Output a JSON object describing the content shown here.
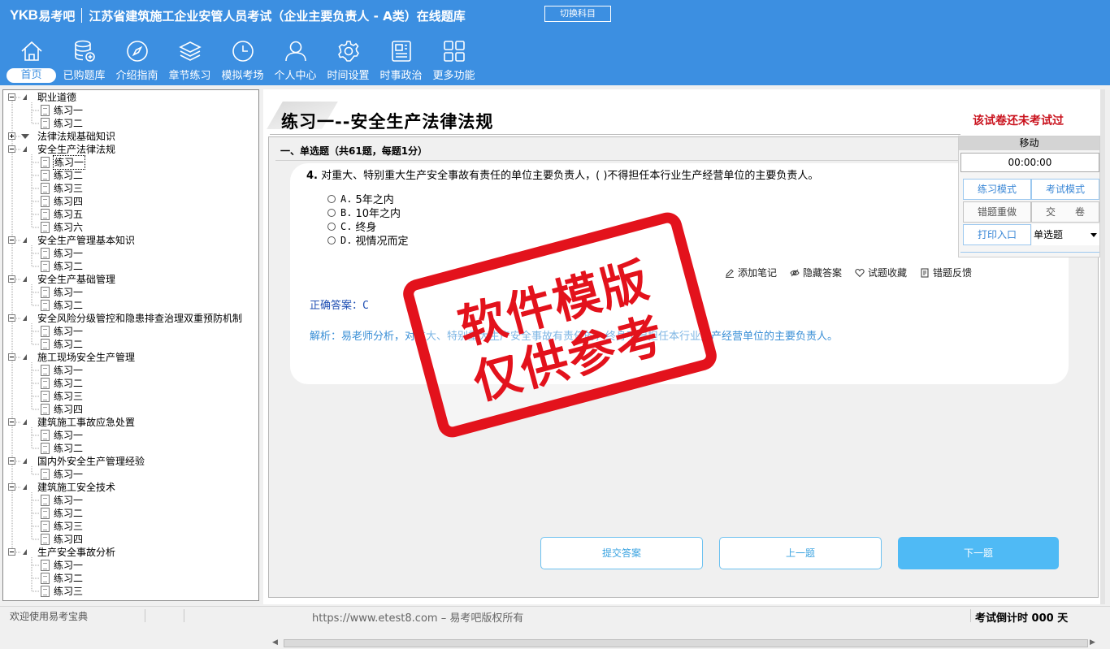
{
  "header": {
    "logo": "YKB",
    "logo_cn": "易考吧",
    "title": "江苏省建筑施工企业安管人员考试（企业主要负责人 - A类）在线题库",
    "switch_button": "切换科目",
    "bg_color": "#3c8fe1"
  },
  "nav": [
    {
      "label": "首页",
      "icon": "home-icon",
      "active": true
    },
    {
      "label": "已购题库",
      "icon": "database-icon"
    },
    {
      "label": "介绍指南",
      "icon": "compass-icon"
    },
    {
      "label": "章节练习",
      "icon": "layers-icon"
    },
    {
      "label": "模拟考场",
      "icon": "clock-icon"
    },
    {
      "label": "个人中心",
      "icon": "user-icon"
    },
    {
      "label": "时间设置",
      "icon": "gear-icon"
    },
    {
      "label": "时事政治",
      "icon": "news-icon"
    },
    {
      "label": "更多功能",
      "icon": "grid-icon"
    }
  ],
  "tree": [
    {
      "label": "职业道德",
      "expanded": true,
      "children": [
        "练习一",
        "练习二"
      ]
    },
    {
      "label": "法律法规基础知识",
      "expanded": false,
      "children": []
    },
    {
      "label": "安全生产法律法规",
      "expanded": true,
      "children": [
        "练习一",
        "练习二",
        "练习三",
        "练习四",
        "练习五",
        "练习六"
      ],
      "selected_child": 0
    },
    {
      "label": "安全生产管理基本知识",
      "expanded": true,
      "children": [
        "练习一",
        "练习二"
      ]
    },
    {
      "label": "安全生产基础管理",
      "expanded": true,
      "children": [
        "练习一",
        "练习二"
      ]
    },
    {
      "label": "安全风险分级管控和隐患排查治理双重预防机制",
      "expanded": true,
      "children": [
        "练习一",
        "练习二"
      ]
    },
    {
      "label": "施工现场安全生产管理",
      "expanded": true,
      "children": [
        "练习一",
        "练习二",
        "练习三",
        "练习四"
      ]
    },
    {
      "label": "建筑施工事故应急处置",
      "expanded": true,
      "children": [
        "练习一",
        "练习二"
      ]
    },
    {
      "label": "国内外安全生产管理经验",
      "expanded": true,
      "children": [
        "练习一"
      ]
    },
    {
      "label": "建筑施工安全技术",
      "expanded": true,
      "children": [
        "练习一",
        "练习二",
        "练习三",
        "练习四"
      ]
    },
    {
      "label": "生产安全事故分析",
      "expanded": true,
      "children": [
        "练习一",
        "练习二",
        "练习三"
      ]
    }
  ],
  "paper": {
    "title": "练习一--安全生产法律法规",
    "status": "该试卷还未考试过",
    "section": "一、单选题（共61题，每题1分）"
  },
  "question": {
    "number": "4.",
    "text": "对重大、特别重大生产安全事故有责任的单位主要负责人，( )不得担任本行业生产经营单位的主要负责人。",
    "options": [
      {
        "tag": "A.",
        "text": "5年之内"
      },
      {
        "tag": "B.",
        "text": "10年之内"
      },
      {
        "tag": "C.",
        "text": "终身"
      },
      {
        "tag": "D.",
        "text": "视情况而定"
      }
    ],
    "answer_label": "正确答案：",
    "answer": "C",
    "analysis": "解析：易老师分析，对重大、特别重大生产安全事故有责任的，终身不得担任本行业生产经营单位的主要负责人。"
  },
  "tools": [
    {
      "label": "添加笔记",
      "icon": "pencil-icon"
    },
    {
      "label": "隐藏答案",
      "icon": "eye-icon"
    },
    {
      "label": "试题收藏",
      "icon": "heart-icon"
    },
    {
      "label": "错题反馈",
      "icon": "report-icon"
    }
  ],
  "buttons": {
    "submit": "提交答案",
    "prev": "上一题",
    "next": "下一题"
  },
  "panel": {
    "header": "移动",
    "timer": "00:00:00",
    "practice_mode": "练习模式",
    "exam_mode": "考试模式",
    "redo_wrong": "错题重做",
    "submit_paper": "交　　卷",
    "print": "打印入口",
    "question_type": "单选题"
  },
  "watermark": {
    "line1": "软件模版",
    "line2": "仅供参考",
    "color": "#e3121c"
  },
  "status": {
    "welcome": "欢迎使用易考宝典",
    "copyright": "https://www.etest8.com – 易考吧版权所有",
    "countdown": "考试倒计时 000 天"
  }
}
